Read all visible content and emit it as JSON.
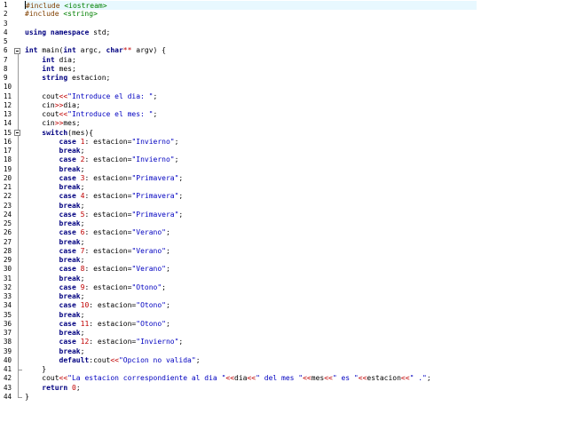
{
  "editor": {
    "current_line": 1,
    "lines": [
      {
        "n": "1",
        "text": "#include <iostream>"
      },
      {
        "n": "2",
        "text": "#include <string>"
      },
      {
        "n": "3",
        "text": ""
      },
      {
        "n": "4",
        "text": "using namespace std;"
      },
      {
        "n": "5",
        "text": ""
      },
      {
        "n": "6",
        "text": "int main(int argc, char** argv) {"
      },
      {
        "n": "7",
        "text": "    int dia;"
      },
      {
        "n": "8",
        "text": "    int mes;"
      },
      {
        "n": "9",
        "text": "    string estacion;"
      },
      {
        "n": "10",
        "text": ""
      },
      {
        "n": "11",
        "text": "    cout<<\"Introduce el dia: \";"
      },
      {
        "n": "12",
        "text": "    cin>>dia;"
      },
      {
        "n": "13",
        "text": "    cout<<\"Introduce el mes: \";"
      },
      {
        "n": "14",
        "text": "    cin>>mes;"
      },
      {
        "n": "15",
        "text": "    switch(mes){"
      },
      {
        "n": "16",
        "text": "        case 1: estacion=\"Invierno\";"
      },
      {
        "n": "17",
        "text": "        break;"
      },
      {
        "n": "18",
        "text": "        case 2: estacion=\"Invierno\";"
      },
      {
        "n": "19",
        "text": "        break;"
      },
      {
        "n": "20",
        "text": "        case 3: estacion=\"Primavera\";"
      },
      {
        "n": "21",
        "text": "        break;"
      },
      {
        "n": "22",
        "text": "        case 4: estacion=\"Primavera\";"
      },
      {
        "n": "23",
        "text": "        break;"
      },
      {
        "n": "24",
        "text": "        case 5: estacion=\"Primavera\";"
      },
      {
        "n": "25",
        "text": "        break;"
      },
      {
        "n": "26",
        "text": "        case 6: estacion=\"Verano\";"
      },
      {
        "n": "27",
        "text": "        break;"
      },
      {
        "n": "28",
        "text": "        case 7: estacion=\"Verano\";"
      },
      {
        "n": "29",
        "text": "        break;"
      },
      {
        "n": "30",
        "text": "        case 8: estacion=\"Verano\";"
      },
      {
        "n": "31",
        "text": "        break;"
      },
      {
        "n": "32",
        "text": "        case 9: estacion=\"Otono\";"
      },
      {
        "n": "33",
        "text": "        break;"
      },
      {
        "n": "34",
        "text": "        case 10: estacion=\"Otono\";"
      },
      {
        "n": "35",
        "text": "        break;"
      },
      {
        "n": "36",
        "text": "        case 11: estacion=\"Otono\";"
      },
      {
        "n": "37",
        "text": "        break;"
      },
      {
        "n": "38",
        "text": "        case 12: estacion=\"Invierno\";"
      },
      {
        "n": "39",
        "text": "        break;"
      },
      {
        "n": "40",
        "text": "        default:cout<<\"Opcion no valida\";"
      },
      {
        "n": "41",
        "text": "    }"
      },
      {
        "n": "42",
        "text": "    cout<<\"La estacion correspondiente al dia \"<<dia<<\" del mes \"<<mes<<\" es \"<<estacion<<\" .\";"
      },
      {
        "n": "43",
        "text": "    return 0;"
      },
      {
        "n": "44",
        "text": "}"
      }
    ],
    "fold_markers": [
      "6",
      "15"
    ],
    "colors": {
      "keyword": "#000080",
      "string": "#0000c0",
      "number": "#c00000",
      "operator": "#c00000",
      "preprocessor": "#804000",
      "include_path": "#008000",
      "current_line_bg": "#e8f8ff"
    }
  }
}
